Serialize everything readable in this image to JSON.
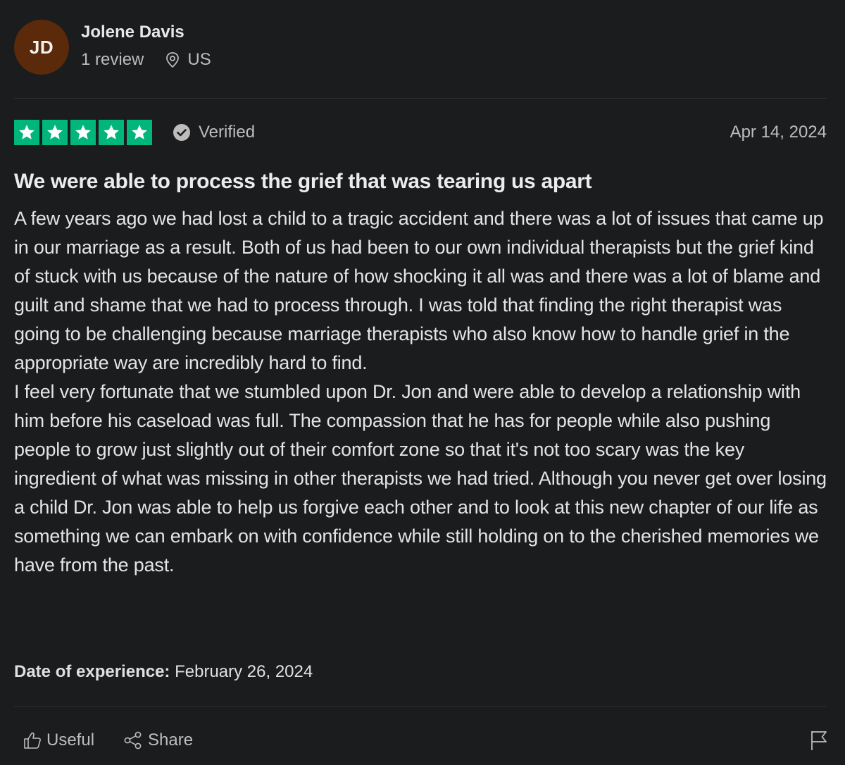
{
  "reviewer": {
    "initials": "JD",
    "name": "Jolene Davis",
    "review_count": "1 review",
    "location": "US",
    "avatar_color": "#5a2a0a"
  },
  "rating": {
    "stars": 5,
    "star_color": "#00b67a",
    "verified_label": "Verified",
    "date": "Apr 14, 2024"
  },
  "review": {
    "title": "We were able to process the grief that was tearing us apart",
    "paragraphs": [
      "A few years ago we had lost a child to a tragic accident and there was a lot of issues that came up in our marriage as a result. Both of us had been to our own individual therapists but the grief kind of stuck with us because of the nature of how shocking it all was and there was a lot of blame and guilt and shame that we had to process through. I was told that finding the right therapist was going to be challenging because marriage therapists who also know how to handle grief in the appropriate way are incredibly hard to find.",
      "I feel very fortunate that we stumbled upon Dr. Jon and were able to develop a relationship with him before his caseload was full. The compassion that he has for people while also pushing people to grow just slightly out of their comfort zone so that it's not too scary was the key ingredient of what was missing in other therapists we had tried. Although you never get over losing a child Dr. Jon was able to help us forgive each other and to look at this new chapter of our life as something we can embark on with confidence while still holding on to the cherished memories we have from the past."
    ],
    "experience_label": "Date of experience:",
    "experience_date": "February 26, 2024"
  },
  "actions": {
    "useful_label": "Useful",
    "share_label": "Share",
    "icons": [
      "thumbs-up-icon",
      "share-icon",
      "flag-icon"
    ]
  }
}
